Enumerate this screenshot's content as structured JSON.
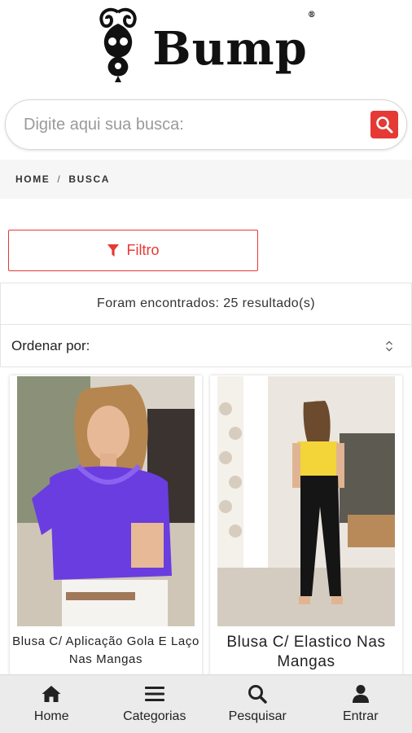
{
  "brand": {
    "name": "Bump",
    "registered": "®"
  },
  "search": {
    "placeholder": "Digite aqui sua busca:",
    "icon": "search-icon"
  },
  "breadcrumb": {
    "items": [
      "HOME",
      "BUSCA"
    ],
    "separator": "/"
  },
  "filter": {
    "label": "Filtro",
    "icon": "filter-icon"
  },
  "results": {
    "text": "Foram encontrados: 25 resultado(s)"
  },
  "sort": {
    "label": "Ordenar por:",
    "icon": "sort-chevrons-icon"
  },
  "products": [
    {
      "title": "Blusa C/ Aplicação Gola E Laço Nas Mangas",
      "image": "woman-purple-blouse-photo"
    },
    {
      "title": "Blusa C/ Elastico Nas Mangas",
      "image": "woman-yellow-top-photo"
    }
  ],
  "bottom_nav": [
    {
      "label": "Home",
      "icon": "home-icon"
    },
    {
      "label": "Categorias",
      "icon": "menu-icon"
    },
    {
      "label": "Pesquisar",
      "icon": "search-icon"
    },
    {
      "label": "Entrar",
      "icon": "user-icon"
    }
  ],
  "colors": {
    "accent": "#e53935",
    "nav_bg": "#ebebeb",
    "breadcrumb_bg": "#f6f6f6"
  }
}
